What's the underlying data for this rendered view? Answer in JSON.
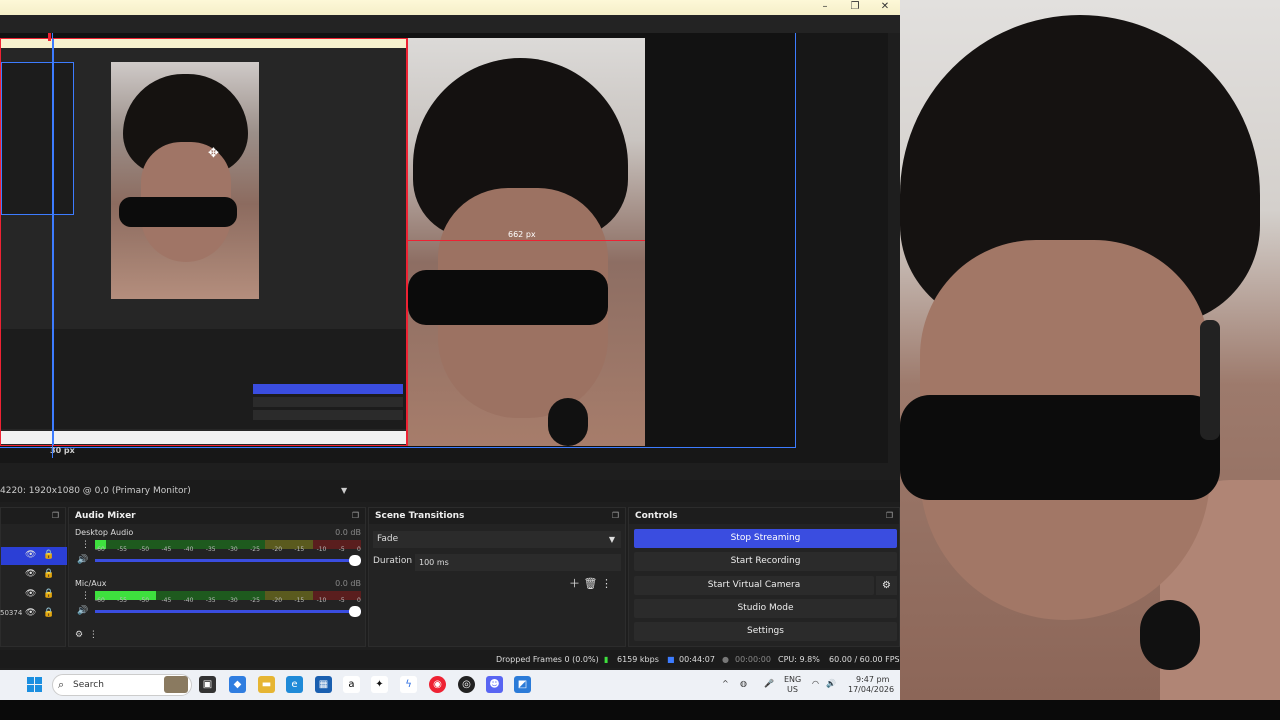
{
  "obs": {
    "preview": {
      "guide_label": "662 px",
      "offset_label": "30 px"
    },
    "source_select": "4220: 1920x1080 @ 0,0 (Primary Monitor)",
    "docks": {
      "audio_mixer": {
        "title": "Audio Mixer",
        "channels": [
          {
            "name": "Desktop Audio",
            "db": "0.0 dB",
            "level": 0.04
          },
          {
            "name": "Mic/Aux",
            "db": "0.0 dB",
            "level": 0.23
          }
        ],
        "ticks": [
          "-60",
          "-55",
          "-50",
          "-45",
          "-40",
          "-35",
          "-30",
          "-25",
          "-20",
          "-15",
          "-10",
          "-5",
          "0"
        ]
      },
      "scene_transitions": {
        "title": "Scene Transitions",
        "transition": "Fade",
        "duration_label": "Duration",
        "duration_value": "100 ms"
      },
      "controls": {
        "title": "Controls",
        "buttons": [
          "Stop Streaming",
          "Start Recording",
          "Start Virtual Camera",
          "Studio Mode",
          "Settings"
        ]
      },
      "sources_side_text": "50374"
    },
    "status": {
      "dropped_frames": "Dropped Frames 0 (0.0%)",
      "bitrate": "6159 kbps",
      "stream_time": "00:44:07",
      "rec_time": "00:00:00",
      "cpu": "CPU: 9.8%",
      "fps": "60.00 / 60.00 FPS"
    }
  },
  "taskbar": {
    "search_placeholder": "Search",
    "tray": {
      "lang": "ENG",
      "region": "US",
      "time": "9:47 pm",
      "date": "17/04/2026"
    }
  },
  "colors": {
    "accent": "#3a4de0",
    "guide_red": "#e22233",
    "bounds_blue": "#3d7cff",
    "meter_green": "#3ee03e"
  }
}
